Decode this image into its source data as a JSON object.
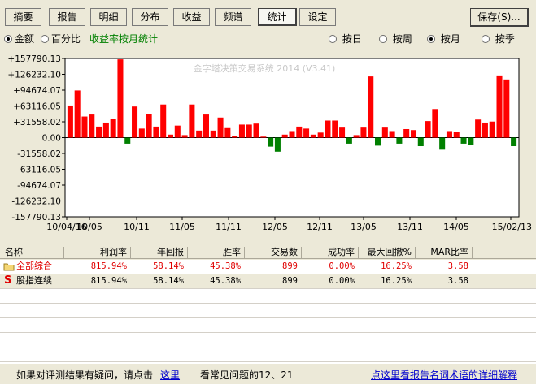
{
  "tabs": [
    {
      "id": "summary",
      "label": "摘要",
      "active": false
    },
    {
      "id": "report",
      "label": "报告",
      "active": false
    },
    {
      "id": "detail",
      "label": "明细",
      "active": false
    },
    {
      "id": "distribution",
      "label": "分布",
      "active": false
    },
    {
      "id": "returns",
      "label": "收益",
      "active": false
    },
    {
      "id": "spectrum",
      "label": "频谱",
      "active": false
    },
    {
      "id": "statistics",
      "label": "统计",
      "active": true
    },
    {
      "id": "settings",
      "label": "设定",
      "active": false
    }
  ],
  "save_button": {
    "label": "保存(S)..."
  },
  "options": {
    "amount_label": "金额",
    "percent_label": "百分比",
    "note": "收益率按月统计",
    "period": [
      {
        "label": "按日",
        "selected": false
      },
      {
        "label": "按周",
        "selected": false
      },
      {
        "label": "按月",
        "selected": true
      },
      {
        "label": "按季",
        "selected": false
      }
    ],
    "amount_selected": true
  },
  "chart_data": {
    "type": "bar",
    "title": "",
    "watermark": "金字塔决策交易系统 2014 (V3.41)",
    "ylim": [
      -157790.13,
      157790.13
    ],
    "yticks": [
      "+157790.13",
      "+126232.10",
      "+94674.07",
      "+63116.05",
      "+31558.02",
      "0.00",
      "-31558.02",
      "-63116.05",
      "-94674.07",
      "-126232.10",
      "-157790.13"
    ],
    "xticks": [
      "10/04/16",
      "10/05",
      "10/11",
      "11/05",
      "11/11",
      "12/05",
      "12/11",
      "13/05",
      "13/11",
      "14/05",
      "15/02/13"
    ],
    "colors": {
      "positive": "#ff0000",
      "negative": "#008000"
    },
    "values": [
      64000,
      94000,
      42000,
      46000,
      22000,
      30000,
      37000,
      156000,
      -12000,
      62000,
      18000,
      47000,
      22000,
      66000,
      6000,
      24000,
      5000,
      66000,
      14000,
      46000,
      14000,
      40000,
      19000,
      3000,
      26000,
      26000,
      28000,
      2000,
      -18000,
      -28000,
      6000,
      13000,
      22000,
      18000,
      6000,
      10000,
      34000,
      34000,
      20000,
      -12000,
      5000,
      20000,
      122000,
      -16000,
      20000,
      13000,
      -12000,
      17000,
      15000,
      -17000,
      33000,
      57000,
      -24000,
      13000,
      11000,
      -12000,
      -15000,
      36000,
      30000,
      32000,
      124000,
      116000,
      -17000
    ]
  },
  "table": {
    "headers": [
      "名称",
      "利润率",
      "年回报",
      "胜率",
      "交易数",
      "成功率",
      "最大回撤%",
      "MAR比率"
    ],
    "rows": [
      {
        "icon": "folder-icon",
        "name": "全部综合",
        "profit": "815.94%",
        "annual": "58.14%",
        "winrate": "45.38%",
        "trades": "899",
        "success": "0.00%",
        "maxdd": "16.25%",
        "mar": "3.58"
      },
      {
        "icon": "strategy-s-icon",
        "icon_text": "S",
        "name": "股指连续",
        "profit": "815.94%",
        "annual": "58.14%",
        "winrate": "45.38%",
        "trades": "899",
        "success": "0.00%",
        "maxdd": "16.25%",
        "mar": "3.58"
      }
    ]
  },
  "footer": {
    "text1": "如果对评测结果有疑问，请点击",
    "link1": "这里",
    "text2": "看常见问题的12、21",
    "link2": "点这里看报告名词术语的详细解释"
  }
}
